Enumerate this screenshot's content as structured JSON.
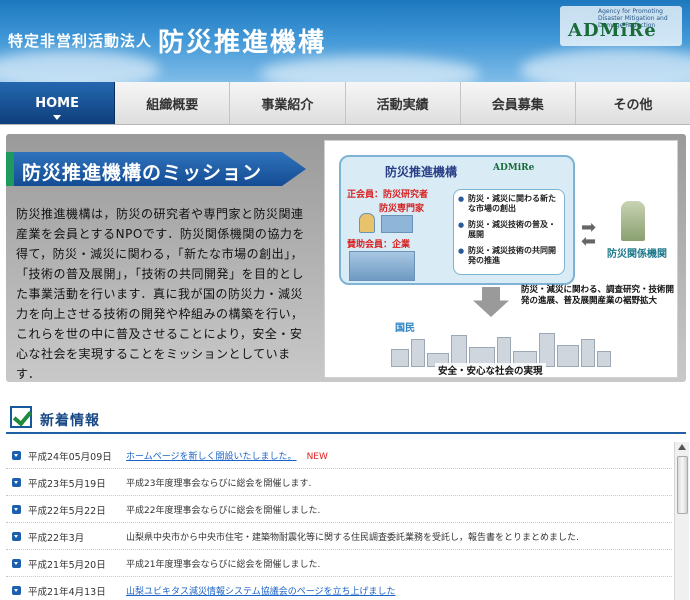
{
  "header": {
    "org_type": "特定非営利活動法人",
    "site_name": "防災推進機構",
    "logo": {
      "text": "ADMiRe",
      "tagline": "Agency for Promoting Disaster Mitigation and Damage Reduction"
    }
  },
  "nav": {
    "items": [
      {
        "label": "HOME",
        "active": true
      },
      {
        "label": "組織概要",
        "active": false
      },
      {
        "label": "事業紹介",
        "active": false
      },
      {
        "label": "活動実績",
        "active": false
      },
      {
        "label": "会員募集",
        "active": false
      },
      {
        "label": "その他",
        "active": false
      }
    ]
  },
  "mission": {
    "title": "防災推進機構のミッション",
    "body": "防災推進機構は，防災の研究者や専門家と防災関連産業を会員とするNPOです．防災関係機関の協力を得て，防災・減災に関わる，「新たな市場の創出」，「技術の普及展開」，「技術の共同開発」を目的とした事業活動を行います．真に我が国の防災力・減災力を向上させる技術の開発や枠組みの構築を行い，これらを世の中に普及させることにより，安全・安心な社会を実現することをミッションとしています．",
    "diagram": {
      "org_title": "防災推進機構",
      "org_logo": "ADMiRe",
      "regular_member_1": "正会員：防災研究者",
      "regular_member_2": "防災専門家",
      "support_member": "賛助会員：企業",
      "activities": [
        "防災・減災に関わる新たな市場の創出",
        "防災・減災技術の普及・展開",
        "防災・減災技術の共同開発の推進"
      ],
      "agency_label": "防災関係機関",
      "research_text": "防災・減災に関わる、調査研究・技術開発の進展、普及展開産業の裾野拡大",
      "citizen_label": "国民",
      "city_label": "安全・安心な社会の実現"
    }
  },
  "news": {
    "title": "新着情報",
    "new_badge": "NEW",
    "items": [
      {
        "date": "平成24年05月09日",
        "text": "ホームページを新しく開設いたしました。",
        "link": true,
        "is_new": true
      },
      {
        "date": "平成23年5月19日",
        "text": "平成23年度理事会ならびに総会を開催します.",
        "link": false,
        "is_new": false
      },
      {
        "date": "平成22年5月22日",
        "text": "平成22年度理事会ならびに総会を開催しました.",
        "link": false,
        "is_new": false
      },
      {
        "date": "平成22年3月",
        "text": "山梨県中央市から中央市住宅・建築物耐震化等に関する住民調査委託業務を受託し，報告書をとりまとめました.",
        "link": false,
        "is_new": false
      },
      {
        "date": "平成21年5月20日",
        "text": "平成21年度理事会ならびに総会を開催しました.",
        "link": false,
        "is_new": false
      },
      {
        "date": "平成21年4月13日",
        "text": "山梨ユビキタス減災情報システム協議会のページを立ち上げました",
        "link": true,
        "is_new": false
      }
    ]
  },
  "colors": {
    "header_blue": "#1d78be",
    "nav_active": "#144c93",
    "link": "#1a63c8",
    "new_red": "#e02020",
    "accent_green": "#1f9a5e"
  }
}
